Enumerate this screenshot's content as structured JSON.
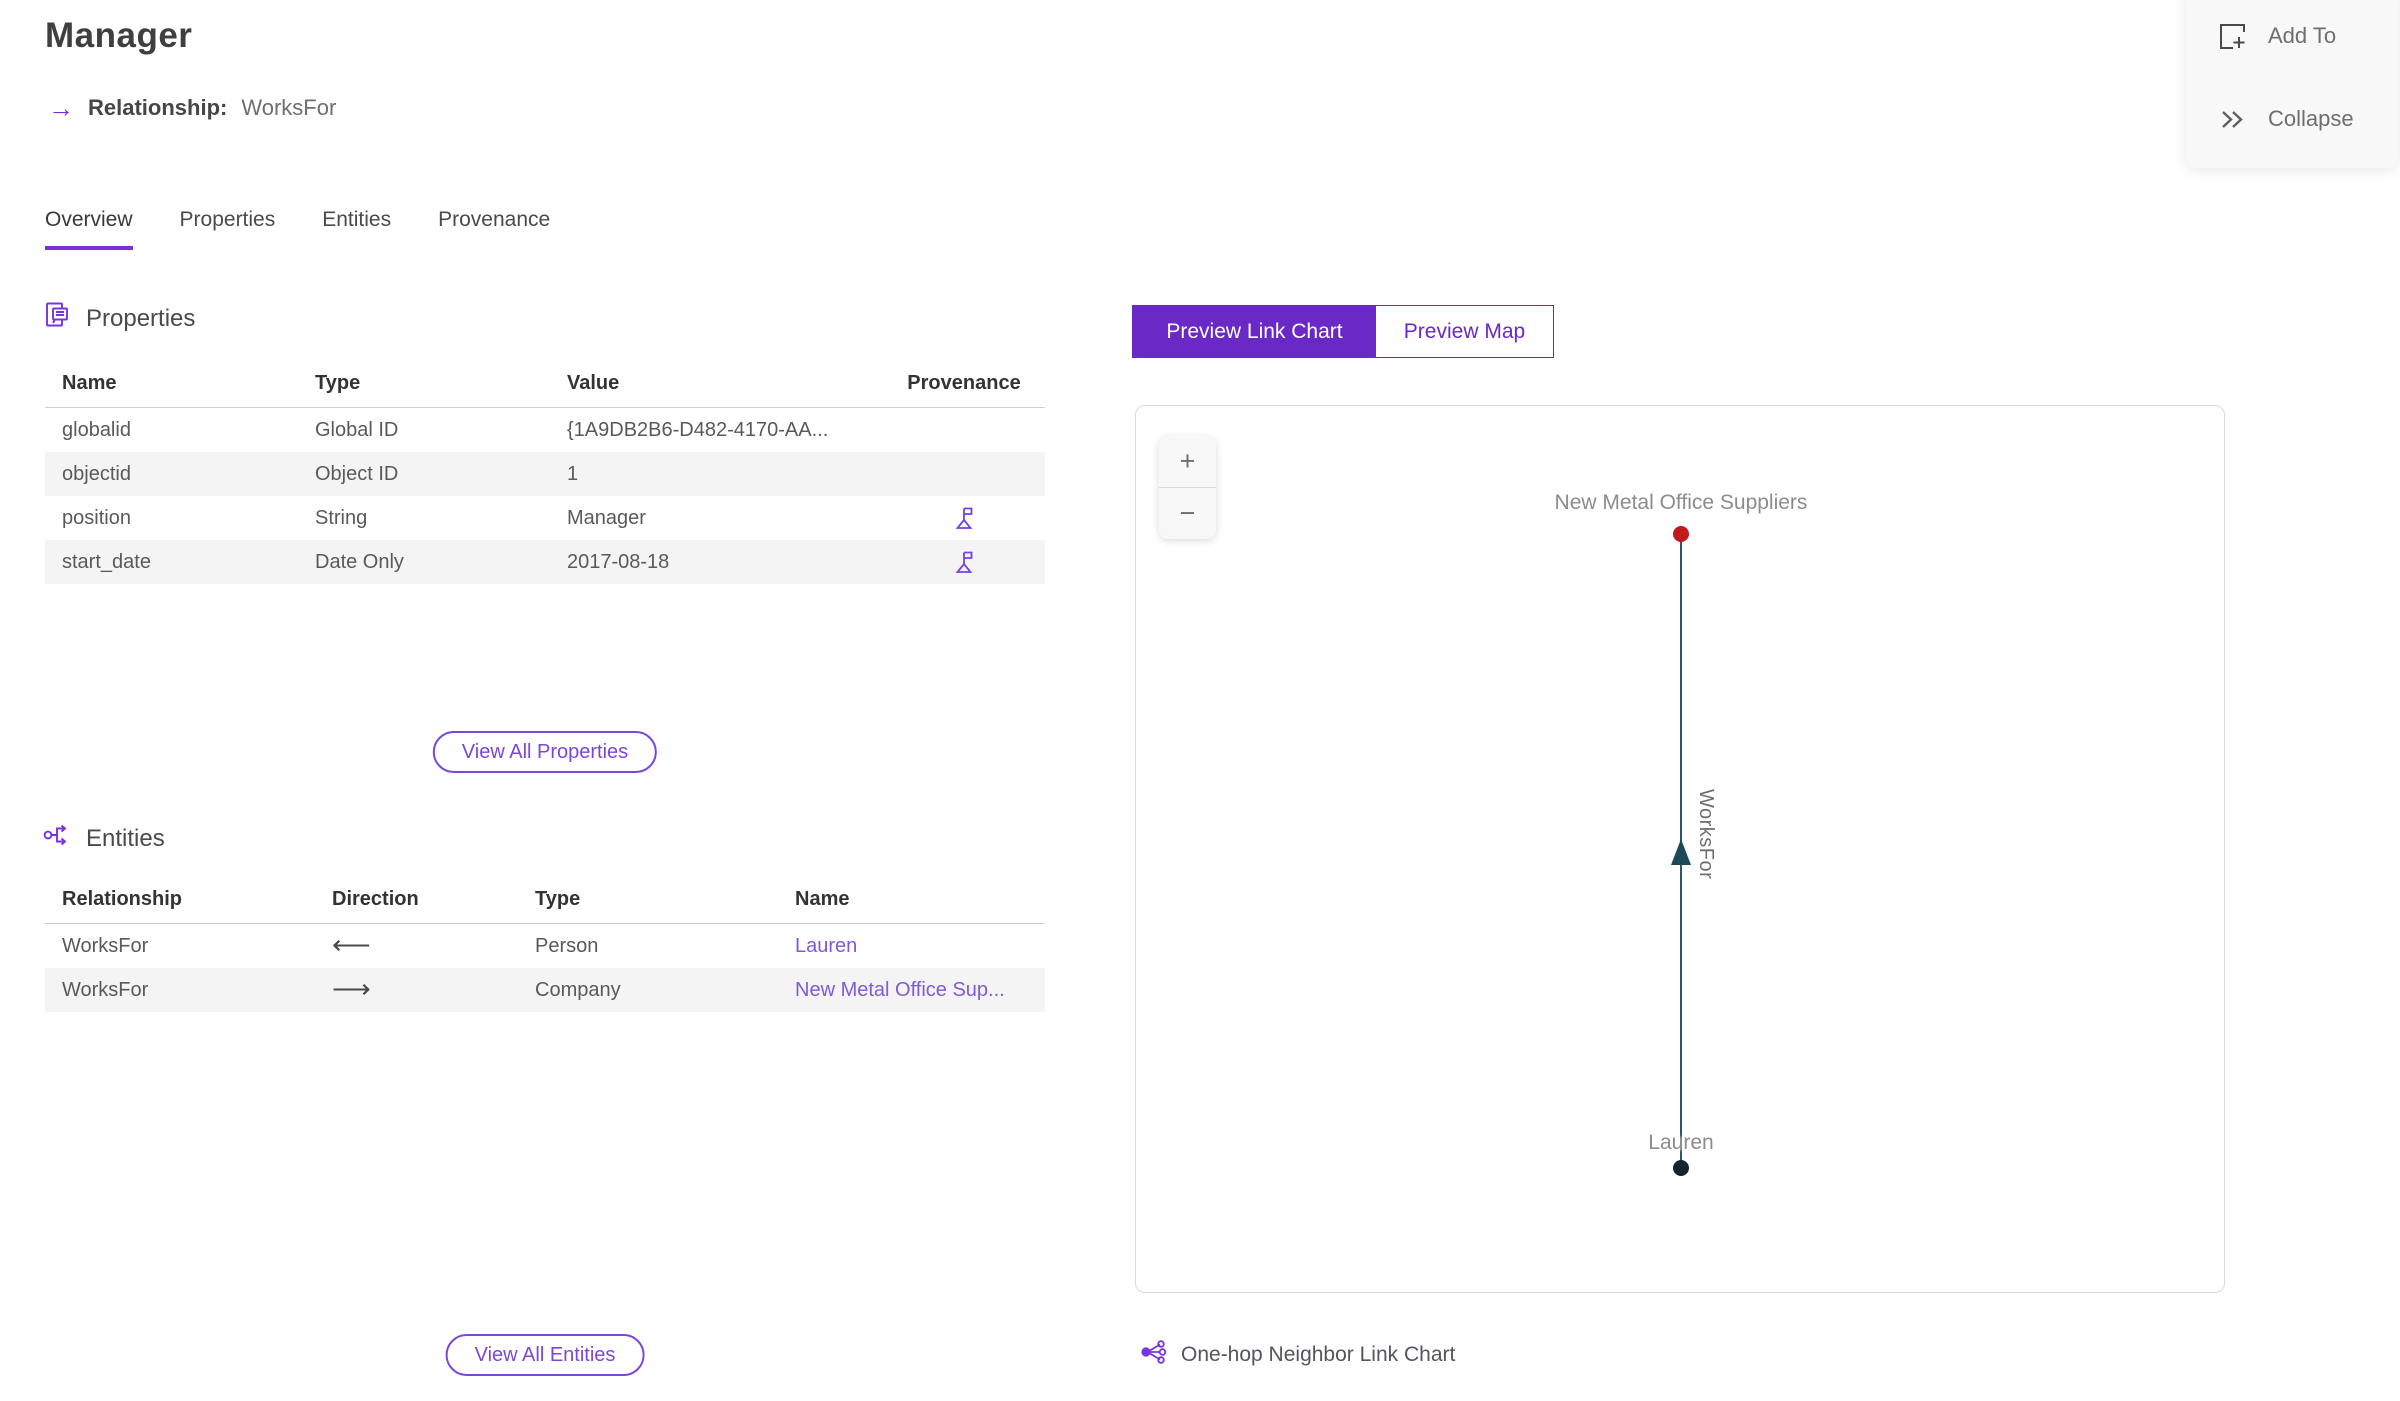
{
  "header": {
    "title": "Manager",
    "relationship_label": "Relationship:",
    "relationship_value": "WorksFor"
  },
  "icons": {
    "relationship_arrow": "→",
    "zoom_in": "+",
    "zoom_out": "−"
  },
  "actions_panel": {
    "add_to_label": "Add To",
    "collapse_label": "Collapse"
  },
  "tabs": [
    {
      "label": "Overview",
      "active": true
    },
    {
      "label": "Properties",
      "active": false
    },
    {
      "label": "Entities",
      "active": false
    },
    {
      "label": "Provenance",
      "active": false
    }
  ],
  "properties_section": {
    "title": "Properties",
    "columns": [
      "Name",
      "Type",
      "Value",
      "Provenance"
    ],
    "rows": [
      {
        "name": "globalid",
        "type": "Global ID",
        "value": "{1A9DB2B6-D482-4170-AA...",
        "has_provenance": false
      },
      {
        "name": "objectid",
        "type": "Object ID",
        "value": "1",
        "has_provenance": false
      },
      {
        "name": "position",
        "type": "String",
        "value": "Manager",
        "has_provenance": true
      },
      {
        "name": "start_date",
        "type": "Date Only",
        "value": "2017-08-18",
        "has_provenance": true
      }
    ],
    "view_all_label": "View All Properties"
  },
  "entities_section": {
    "title": "Entities",
    "columns": [
      "Relationship",
      "Direction",
      "Type",
      "Name"
    ],
    "rows": [
      {
        "relationship": "WorksFor",
        "direction": "⟵",
        "type": "Person",
        "name": "Lauren"
      },
      {
        "relationship": "WorksFor",
        "direction": "⟶",
        "type": "Company",
        "name": "New Metal Office Sup..."
      }
    ],
    "view_all_label": "View All Entities"
  },
  "preview": {
    "toggle": [
      {
        "label": "Preview Link Chart",
        "active": true
      },
      {
        "label": "Preview Map",
        "active": false
      }
    ],
    "caption": "One-hop Neighbor Link Chart",
    "link_chart": {
      "nodes": [
        {
          "label": "New Metal Office Suppliers",
          "type": "Company",
          "color": "#c11a1a"
        },
        {
          "label": "Lauren",
          "type": "Person",
          "color": "#16242f"
        }
      ],
      "edge": {
        "label": "WorksFor",
        "from": "Lauren",
        "to": "New Metal Office Suppliers",
        "color": "#27596a"
      }
    }
  },
  "colors": {
    "accent_purple": "#6a28c7",
    "link_purple": "#8159d6",
    "icon_purple": "#6f42ea",
    "edge_teal": "#27596a",
    "node_red": "#c11a1a",
    "node_dark": "#16242f"
  }
}
